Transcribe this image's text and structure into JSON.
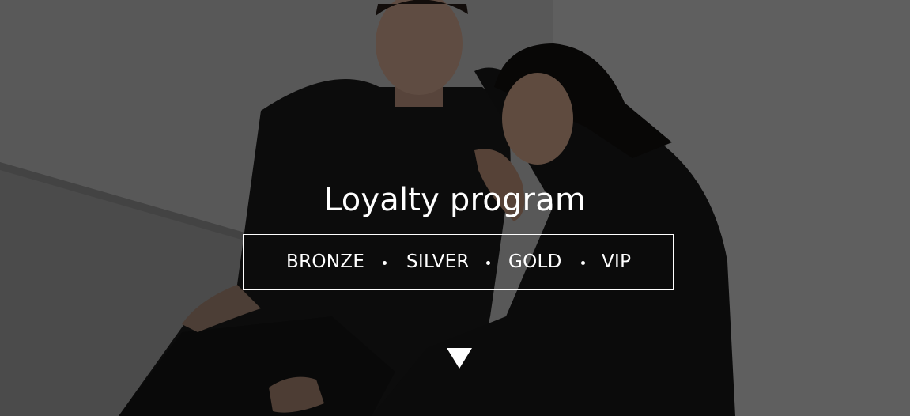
{
  "hero": {
    "title": "Loyalty program",
    "tiers": [
      {
        "label": "BRONZE"
      },
      {
        "label": "SILVER"
      },
      {
        "label": "GOLD"
      },
      {
        "label": "VIP"
      }
    ],
    "scroll_icon": "triangle-down-icon"
  },
  "colors": {
    "text": "#ffffff",
    "overlay": "#000000"
  }
}
